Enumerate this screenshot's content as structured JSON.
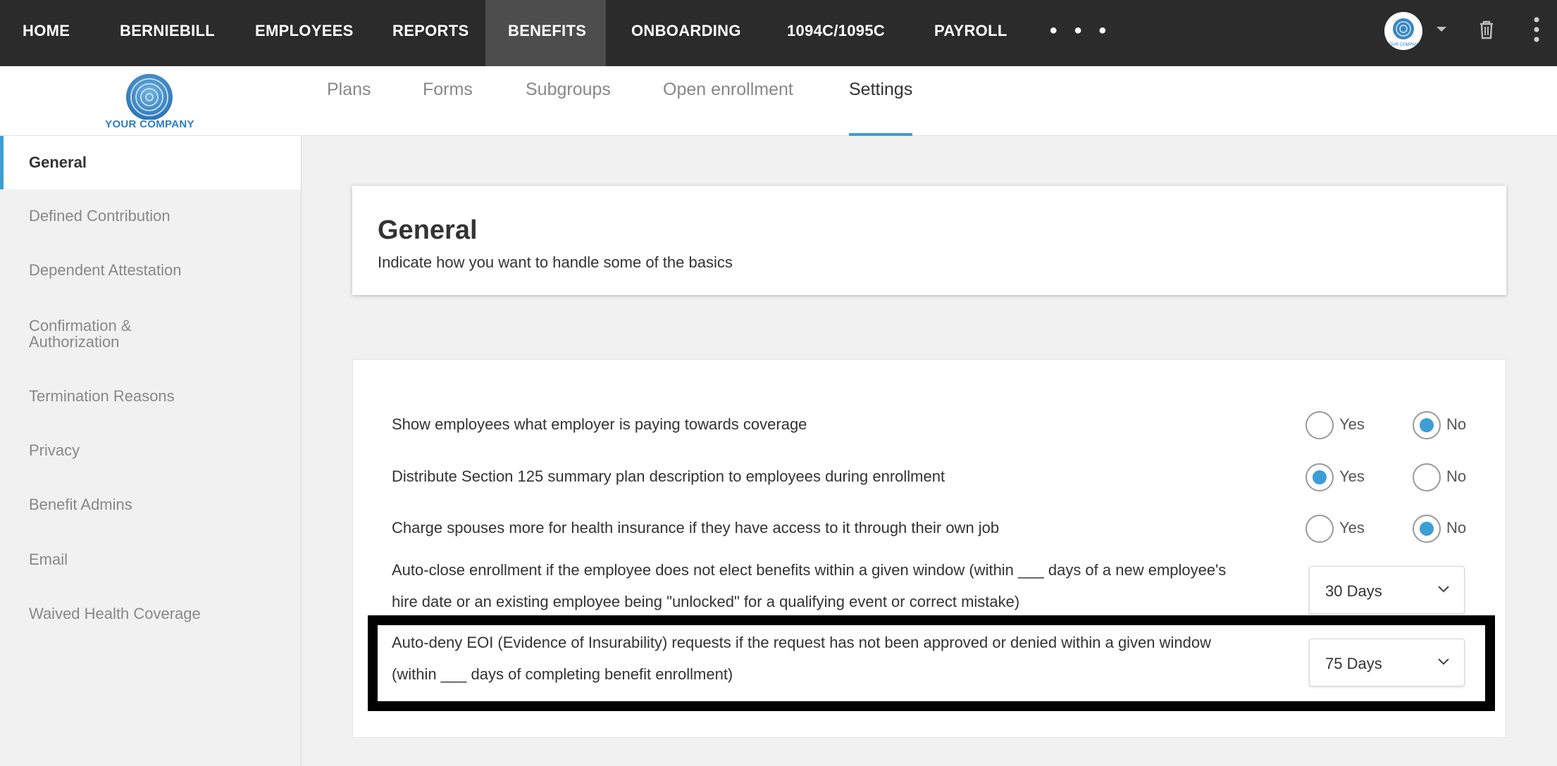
{
  "topnav": {
    "items": [
      "HOME",
      "BERNIEBILL",
      "EMPLOYEES",
      "REPORTS",
      "BENEFITS",
      "ONBOARDING",
      "1094C/1095C",
      "PAYROLL"
    ],
    "active": "BENEFITS",
    "more": "• • •",
    "avatar_text": "YOUR COMPANY"
  },
  "logo": {
    "text": "YOUR COMPANY"
  },
  "subtabs": {
    "items": [
      "Plans",
      "Forms",
      "Subgroups",
      "Open enrollment",
      "Settings"
    ],
    "active": "Settings"
  },
  "sidebar": {
    "items": [
      "General",
      "Defined Contribution",
      "Dependent Attestation",
      "Confirmation & Authorization",
      "Termination Reasons",
      "Privacy",
      "Benefit Admins",
      "Email",
      "Waived Health Coverage"
    ],
    "item4_line1": "Confirmation &",
    "item4_line2": "Authorization",
    "active": "General"
  },
  "header_card": {
    "title": "General",
    "subtitle": "Indicate how you want to handle some of the basics"
  },
  "settings": {
    "yes_label": "Yes",
    "no_label": "No",
    "rows": [
      {
        "label": "Show employees what employer is paying towards coverage",
        "value": "No"
      },
      {
        "label": "Distribute Section 125 summary plan description to employees during enrollment",
        "value": "Yes"
      },
      {
        "label": "Charge spouses more for health insurance if they have access to it through their own job",
        "value": "No"
      }
    ],
    "autoclose": {
      "line1": "Auto-close enrollment if the employee does not elect benefits within a given window (within ___ days of a new employee's",
      "line2": "hire date or an existing employee being \"unlocked\" for a qualifying event or correct mistake)",
      "value": "30 Days"
    },
    "autodeny": {
      "line1": "Auto-deny EOI (Evidence of Insurability) requests if the request has not been approved or denied within a given window",
      "line2": "(within ___ days of completing benefit enrollment)",
      "value": "75 Days"
    }
  },
  "colors": {
    "topnav_bg": "#2b2b2b",
    "accent": "#3d9ed6",
    "highlight_border": "#000000"
  }
}
